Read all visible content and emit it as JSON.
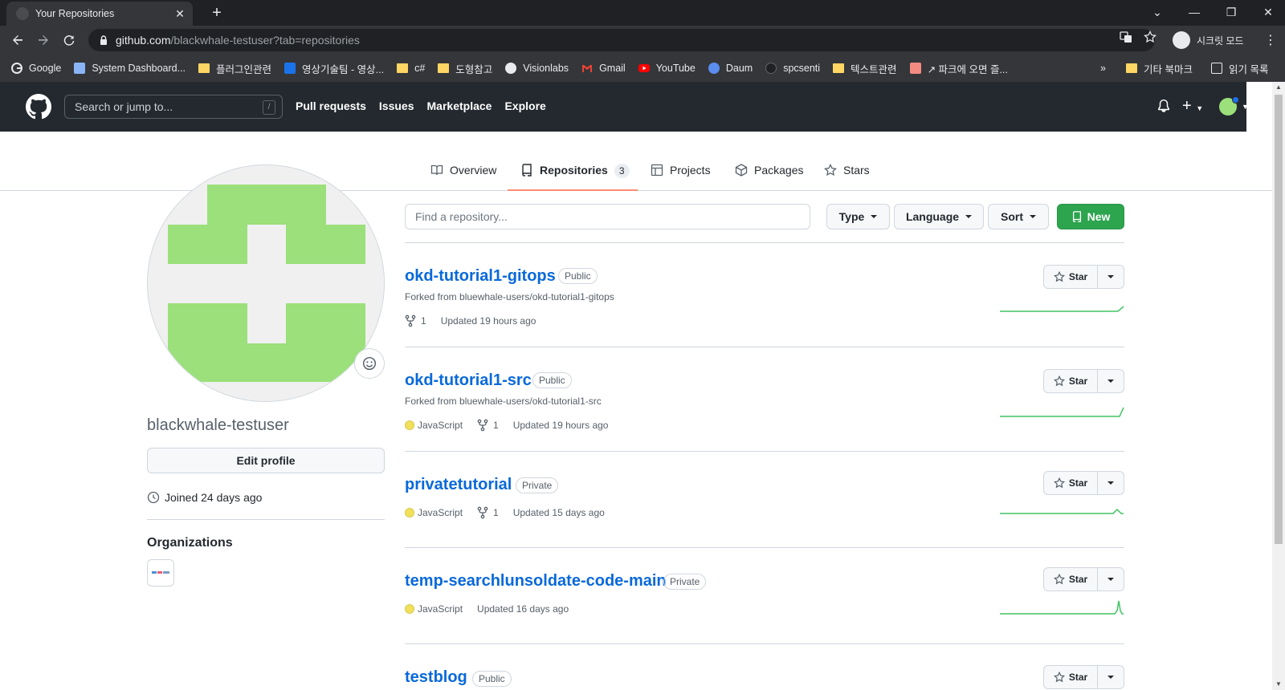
{
  "browser": {
    "tab_title": "Your Repositories",
    "url_host": "github.com",
    "url_path": "/blackwhale-testuser?tab=repositories",
    "incognito_label": "시크릿 모드",
    "bookmarks": [
      {
        "label": "Google",
        "icon": "google-icon"
      },
      {
        "label": "System Dashboard...",
        "icon": "dashboard-icon"
      },
      {
        "label": "플러그인관련",
        "icon": "folder-icon"
      },
      {
        "label": "영상기술팀 - 영상...",
        "icon": "site-icon"
      },
      {
        "label": "c#",
        "icon": "folder-icon"
      },
      {
        "label": "도형참고",
        "icon": "folder-icon"
      },
      {
        "label": "Visionlabs",
        "icon": "site-icon"
      },
      {
        "label": "Gmail",
        "icon": "gmail-icon"
      },
      {
        "label": "YouTube",
        "icon": "youtube-icon"
      },
      {
        "label": "Daum",
        "icon": "daum-icon"
      },
      {
        "label": "spcsenti",
        "icon": "github-icon"
      },
      {
        "label": "텍스트관련",
        "icon": "folder-icon"
      },
      {
        "label": "↗ 파크에 오면 즐...",
        "icon": "site-icon"
      }
    ],
    "bookmarks_overflow": "»",
    "other_bookmarks": "기타 북마크",
    "reading_list": "읽기 목록"
  },
  "header": {
    "search_placeholder": "Search or jump to...",
    "search_key": "/",
    "nav": [
      "Pull requests",
      "Issues",
      "Marketplace",
      "Explore"
    ]
  },
  "profile_tabs": [
    {
      "label": "Overview",
      "icon": "book-icon"
    },
    {
      "label": "Repositories",
      "icon": "repo-icon",
      "count": "3"
    },
    {
      "label": "Projects",
      "icon": "table-icon"
    },
    {
      "label": "Packages",
      "icon": "package-icon"
    },
    {
      "label": "Stars",
      "icon": "star-icon"
    }
  ],
  "profile": {
    "username": "blackwhale-testuser",
    "edit_label": "Edit profile",
    "joined": "Joined 24 days ago",
    "organizations_title": "Organizations"
  },
  "filters": {
    "search_placeholder": "Find a repository...",
    "type": "Type",
    "language": "Language",
    "sort": "Sort",
    "new": "New"
  },
  "repos": [
    {
      "name": "okd-tutorial1-gitops",
      "visibility": "Public",
      "forked_from": "Forked from bluewhale-users/okd-tutorial1-gitops",
      "language": "",
      "forks": "1",
      "updated": "Updated 19 hours ago",
      "star": "Star"
    },
    {
      "name": "okd-tutorial1-src",
      "visibility": "Public",
      "forked_from": "Forked from bluewhale-users/okd-tutorial1-src",
      "language": "JavaScript",
      "forks": "1",
      "updated": "Updated 19 hours ago",
      "star": "Star"
    },
    {
      "name": "privatetutorial",
      "visibility": "Private",
      "forked_from": "",
      "language": "JavaScript",
      "forks": "1",
      "updated": "Updated 15 days ago",
      "star": "Star"
    },
    {
      "name": "temp-searchlunsoldate-code-main",
      "visibility": "Private",
      "forked_from": "",
      "language": "JavaScript",
      "forks": "",
      "updated": "Updated 16 days ago",
      "star": "Star"
    },
    {
      "name": "testblog",
      "visibility": "Public",
      "forked_from": "",
      "language": "",
      "forks": "",
      "updated": "",
      "star": "Star"
    }
  ],
  "colors": {
    "link": "#0969da",
    "new_button": "#2da44e",
    "tab_underline": "#fd8c73",
    "javascript": "#f1e05a",
    "identicon": "#9be07a",
    "sparkline": "#40c463"
  }
}
